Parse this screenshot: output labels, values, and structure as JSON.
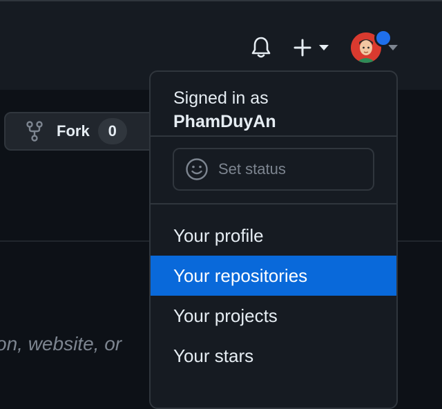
{
  "header": {
    "notifications_icon": "bell-icon",
    "create_icon": "plus-icon",
    "avatar_icon": "avatar"
  },
  "repo": {
    "fork_label": "Fork",
    "fork_count": "0",
    "description_placeholder": "on, website, or"
  },
  "dropdown": {
    "signed_in_label": "Signed in as",
    "username": "PhamDuyAn",
    "status_placeholder": "Set status",
    "items": [
      {
        "label": "Your profile"
      },
      {
        "label": "Your repositories"
      },
      {
        "label": "Your projects"
      },
      {
        "label": "Your stars"
      }
    ],
    "active_index": 1
  },
  "colors": {
    "background": "#0d1117",
    "header_bg": "#161b22",
    "accent": "#0969da",
    "notification_dot": "#1f6feb",
    "muted_text": "#7d8590"
  }
}
